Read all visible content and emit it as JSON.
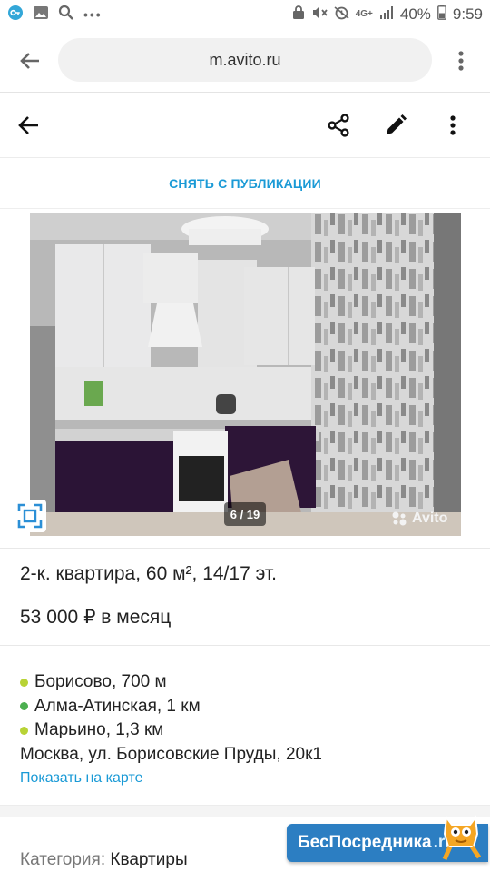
{
  "status_bar": {
    "left_icons": [
      "vpn-key-icon",
      "gallery-icon",
      "search-icon",
      "more-icon"
    ],
    "right_icons": [
      "lock-icon",
      "mute-icon",
      "alarm-icon",
      "network-icon",
      "signal-icon",
      "battery-icon"
    ],
    "network": "4G+",
    "battery": "40%",
    "time": "9:59"
  },
  "browser": {
    "url": "m.avito.ru",
    "back_icon": "arrow-back-icon",
    "menu_icon": "kebab-menu-icon"
  },
  "app_bar": {
    "back_icon": "arrow-back-icon",
    "share_icon": "share-icon",
    "edit_icon": "pencil-icon",
    "menu_icon": "kebab-menu-icon"
  },
  "actions": {
    "unpublish_label": "СНЯТЬ С ПУБЛИКАЦИИ"
  },
  "gallery": {
    "counter": "6 / 19",
    "watermark": "Avito",
    "fullscreen_icon": "fullscreen-icon"
  },
  "listing": {
    "title": "2-к. квартира, 60 м², 14/17 эт.",
    "price": "53 000 ₽ в месяц"
  },
  "location": {
    "metro": [
      {
        "text": "Борисово, 700 м",
        "color": "#b8d335"
      },
      {
        "text": "Алма-Атинская, 1 км",
        "color": "#4caf50"
      },
      {
        "text": "Марьино, 1,3 км",
        "color": "#b8d335"
      }
    ],
    "address": "Москва, ул. Борисовские Пруды, 20к1",
    "map_link": "Показать на карте"
  },
  "category": {
    "label": "Категория:",
    "value": "Квартиры"
  },
  "promo": {
    "text": "БесПосредника",
    "suffix": ".ru"
  },
  "colors": {
    "accent": "#1a9ad6",
    "promo_bg": "#2c7ec2"
  }
}
